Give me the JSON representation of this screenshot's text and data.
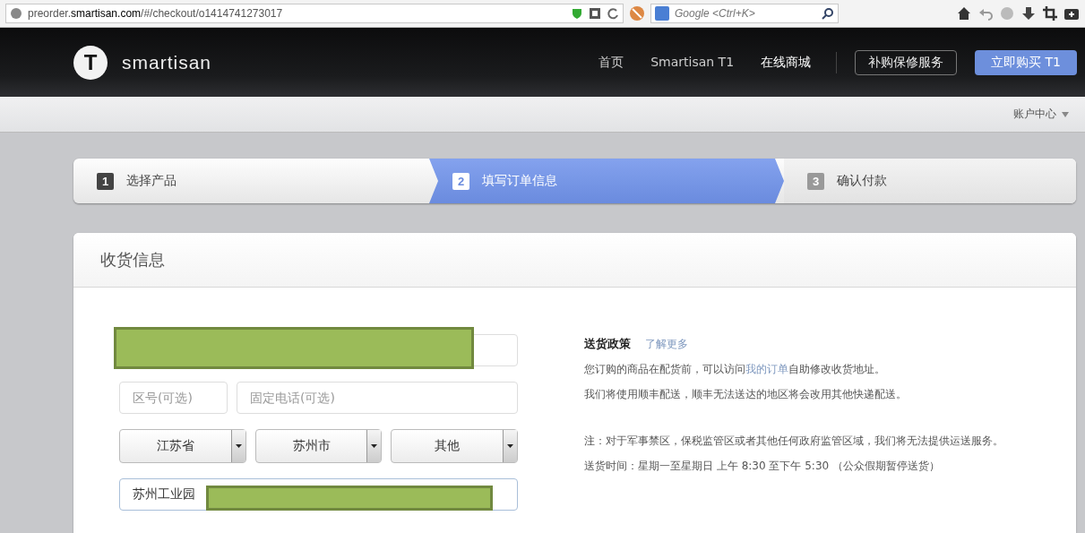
{
  "browser": {
    "url_host": "preorder.",
    "url_domain": "smartisan.com",
    "url_path": "/#/checkout/o1414741273017",
    "search": {
      "placeholder": "Google <Ctrl+K>"
    }
  },
  "header": {
    "logo_letter": "T",
    "brand": "smartisan",
    "nav": [
      {
        "label": "首页",
        "selected": false
      },
      {
        "label": "Smartisan T1",
        "selected": false
      },
      {
        "label": "在线商城",
        "selected": true
      }
    ],
    "service_button": "补购保修服务",
    "buy_button": "立即购买 T1"
  },
  "subnav": {
    "account": "账户中心"
  },
  "steps": [
    {
      "number": "1",
      "label": "选择产品",
      "selected": false,
      "completed": true
    },
    {
      "number": "2",
      "label": "填写订单信息",
      "selected": true,
      "completed": false
    },
    {
      "number": "3",
      "label": "确认付款",
      "selected": false,
      "completed": false
    }
  ],
  "card": {
    "title": "收货信息",
    "form": {
      "name_field": {
        "redacted": true
      },
      "area_code": {
        "placeholder": "区号(可选)"
      },
      "phone": {
        "placeholder": "固定电话(可选)"
      },
      "selects": [
        {
          "value": "江苏省"
        },
        {
          "value": "苏州市"
        },
        {
          "value": "其他"
        }
      ],
      "address": {
        "value": "苏州工业园",
        "redacted": true
      }
    },
    "policy": {
      "title": "送货政策",
      "more_link": "了解更多",
      "line_1": {
        "before": "您订购的商品在配货前，可以访问",
        "link": "我的订单",
        "after": "自助修改收货地址。"
      },
      "line_2": "我们将使用顺丰配送，顺丰无法送达的地区将会改用其他快递配送。",
      "note": "注：对于军事禁区，保税监管区或者其他任何政府监管区域，我们将无法提供运送服务。",
      "hours": "送货时间：星期一至星期日 上午 8:30 至下午 5:30 （公众假期暂停送货）"
    }
  }
}
